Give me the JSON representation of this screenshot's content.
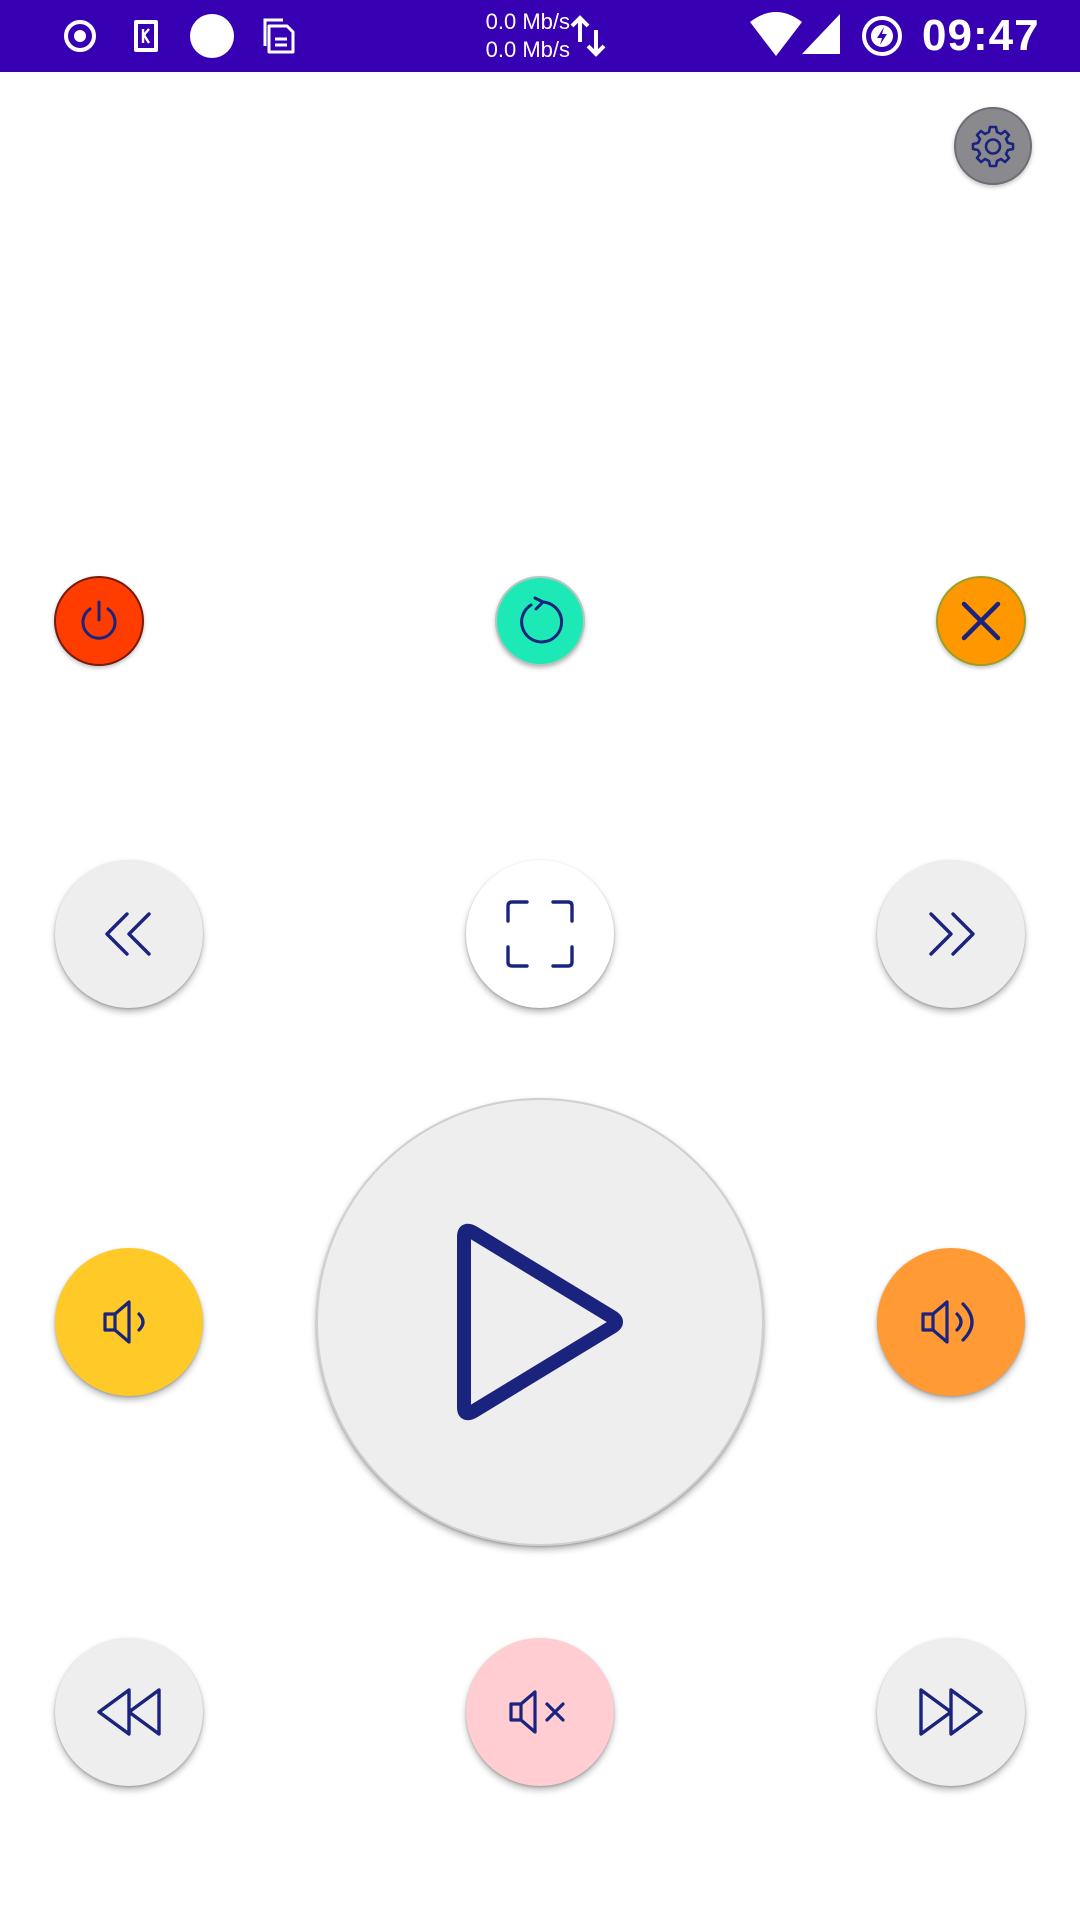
{
  "status_bar": {
    "background_color": "#3700b3",
    "left_icons": [
      "record-dot-icon",
      "app-k-icon",
      "white-circle-icon",
      "clipboard-icon"
    ],
    "net_speed_up": "0.0 Mb/s",
    "net_speed_down": "0.0 Mb/s",
    "right_icons": [
      "updown-arrows-icon",
      "wifi-icon",
      "cell-signal-icon",
      "battery-charging-icon"
    ],
    "time": "09:47"
  },
  "colors": {
    "icon_stroke": "#1a237e",
    "power": "#ff3d00",
    "refresh": "#1de9b6",
    "close": "#ff9800",
    "settings": "#8a8a8e",
    "neutral_button": "#eeeeee",
    "fullscreen_button": "#ffffff",
    "volume_down": "#ffca28",
    "volume_up": "#ff9a35",
    "mute": "#ffcdd2"
  },
  "controls": {
    "top_right": [
      "gear-icon"
    ],
    "row1": [
      "power-icon",
      "refresh-icon",
      "close-icon"
    ],
    "row2": [
      "double-chevron-left-icon",
      "fullscreen-icon",
      "double-chevron-right-icon"
    ],
    "row3": [
      "volume-down-icon",
      "play-icon",
      "volume-up-icon"
    ],
    "row4": [
      "rewind-icon",
      "mute-icon",
      "fast-forward-icon"
    ]
  }
}
